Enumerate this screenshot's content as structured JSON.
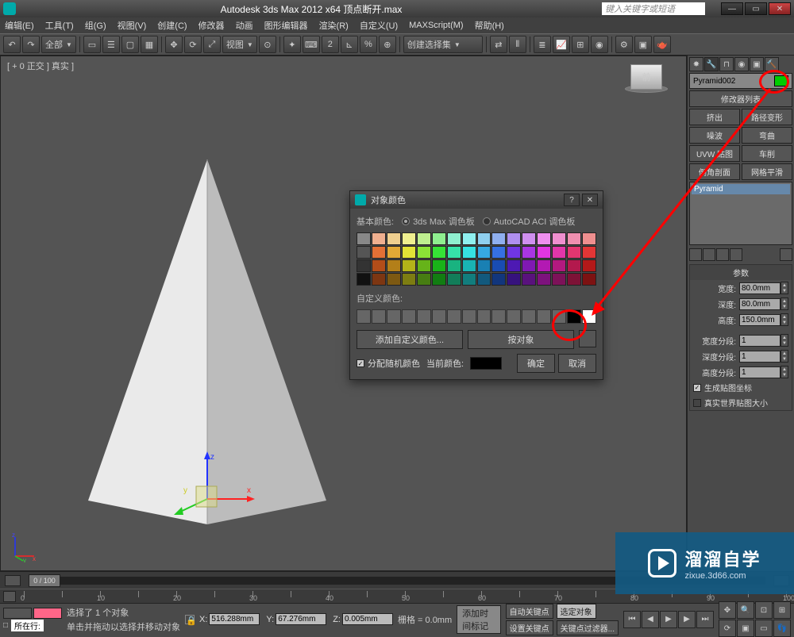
{
  "title": "Autodesk 3ds Max 2012 x64     顶点断开.max",
  "search_placeholder": "键入关键字或短语",
  "menu": [
    "编辑(E)",
    "工具(T)",
    "组(G)",
    "视图(V)",
    "创建(C)",
    "修改器",
    "动画",
    "图形编辑器",
    "渲染(R)",
    "自定义(U)",
    "MAXScript(M)",
    "帮助(H)"
  ],
  "toolbar": {
    "allsel": "全部",
    "view": "视图",
    "createset": "创建选择集"
  },
  "viewport": {
    "label": "[ + 0 正交 ] 真实 ]"
  },
  "panel": {
    "objname": "Pyramid002",
    "modlist_label": "修改器列表",
    "shelf": [
      "挤出",
      "路径变形",
      "噪波",
      "弯曲",
      "UVW 贴图",
      "车削",
      "倒角剖面",
      "网格平滑"
    ],
    "stack_sel": "Pyramid",
    "params_title": "参数",
    "width_l": "宽度:",
    "width_v": "80.0mm",
    "depth_l": "深度:",
    "depth_v": "80.0mm",
    "height_l": "高度:",
    "height_v": "150.0mm",
    "wseg_l": "宽度分段:",
    "wseg_v": "1",
    "dseg_l": "深度分段:",
    "dseg_v": "1",
    "hseg_l": "高度分段:",
    "hseg_v": "1",
    "genmap": "生成贴图坐标",
    "realworld": "真实世界贴图大小"
  },
  "dialog": {
    "title": "对象颜色",
    "basic": "基本颜色:",
    "p1": "3ds Max 调色板",
    "p2": "AutoCAD ACI 调色板",
    "custom": "自定义颜色:",
    "addcustom": "添加自定义颜色...",
    "byobj": "按对象",
    "assignrand": "分配随机颜色",
    "current": "当前颜色:",
    "ok": "确定",
    "cancel": "取消"
  },
  "timeline": {
    "frame": "0 / 100"
  },
  "status": {
    "selcount": "选择了 1 个对象",
    "hint": "单击并拖动以选择并移动对象",
    "x": "516.288mm",
    "y": "67.276mm",
    "z": "0.005mm",
    "grid": "栅格 = 0.0mm",
    "autokey": "自动关键点",
    "seldefn": "选定对象",
    "setkey": "设置关键点",
    "keyfilter": "关键点过滤器...",
    "addtag": "添加时间标记",
    "line": "所在行:"
  },
  "watermark": {
    "big": "溜溜自学",
    "sm": "zixue.3d66.com"
  },
  "chart_data": {
    "type": "table",
    "note": "no chart present"
  }
}
